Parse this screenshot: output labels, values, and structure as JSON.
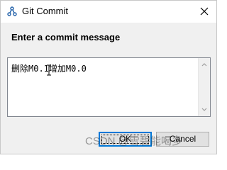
{
  "window": {
    "title": "Git Commit",
    "app_icon": "git-commit-icon",
    "close_icon": "close-icon"
  },
  "prompt": {
    "label": "Enter a commit message"
  },
  "message": {
    "value": "删除M0.1增加M0.0"
  },
  "buttons": {
    "ok_label": "OK",
    "cancel_label": "Cancel"
  },
  "watermark": {
    "text": "CSDN @雪碧能喝多"
  },
  "colors": {
    "accent": "#0078d7",
    "dialog_bg": "#f0f0f0"
  }
}
